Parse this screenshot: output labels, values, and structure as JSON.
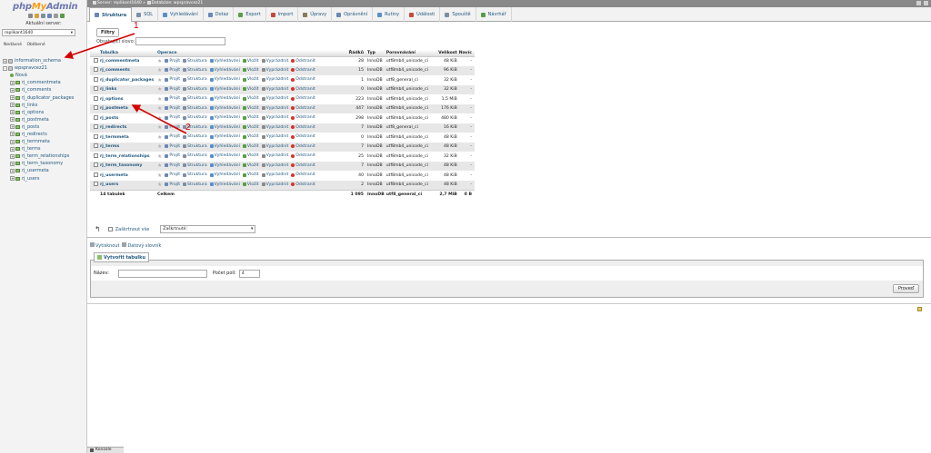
{
  "app": {
    "logo_php": "php",
    "logo_my": "My",
    "logo_admin": "Admin"
  },
  "nav": {
    "server_label": "Aktuální server:",
    "server_value": "replikant1640",
    "recent": "Nedávné",
    "favorites": "Oblíbené",
    "tree": [
      {
        "label": "information_schema",
        "kind": "db",
        "expander": "+"
      },
      {
        "label": "wpspravcez21",
        "kind": "db",
        "expander": "-"
      },
      {
        "label": "Nová",
        "kind": "new"
      },
      {
        "label": "rj_commentmeta",
        "kind": "table"
      },
      {
        "label": "rj_comments",
        "kind": "table"
      },
      {
        "label": "rj_duplicator_packages",
        "kind": "table"
      },
      {
        "label": "rj_links",
        "kind": "table"
      },
      {
        "label": "rj_options",
        "kind": "table"
      },
      {
        "label": "rj_postmeta",
        "kind": "table"
      },
      {
        "label": "rj_posts",
        "kind": "table"
      },
      {
        "label": "rj_redirects",
        "kind": "table"
      },
      {
        "label": "rj_termmeta",
        "kind": "table"
      },
      {
        "label": "rj_terms",
        "kind": "table"
      },
      {
        "label": "rj_term_relationships",
        "kind": "table"
      },
      {
        "label": "rj_term_taxonomy",
        "kind": "table"
      },
      {
        "label": "rj_usermeta",
        "kind": "table"
      },
      {
        "label": "rj_users",
        "kind": "table"
      }
    ]
  },
  "topbar": {
    "server": "Server: replikant1640",
    "sep": "»",
    "database": "Databáze: wpspravcez21"
  },
  "tabs": [
    {
      "label": "Struktura",
      "active": true,
      "color": "#6a87b6"
    },
    {
      "label": "SQL",
      "color": "#7d8fa8"
    },
    {
      "label": "Vyhledávání",
      "color": "#5c8fc7"
    },
    {
      "label": "Dotaz",
      "color": "#6a87b6"
    },
    {
      "label": "Export",
      "color": "#5a9c48"
    },
    {
      "label": "Import",
      "color": "#c44b3d"
    },
    {
      "label": "Úpravy",
      "color": "#8a7a5a"
    },
    {
      "label": "Oprávnění",
      "color": "#6a87b6"
    },
    {
      "label": "Rutiny",
      "color": "#5c8fc7"
    },
    {
      "label": "Události",
      "color": "#c44b3d"
    },
    {
      "label": "Spouště",
      "color": "#7d8fa8"
    },
    {
      "label": "Návrhář",
      "color": "#5a9c48"
    }
  ],
  "filter": {
    "button": "Filtry",
    "label": "Obsahující slovo:",
    "value": ""
  },
  "table": {
    "headers": {
      "table": "Tabulka",
      "ops": "Operace",
      "rows": "Řádků",
      "type": "Typ",
      "collation": "Porovnávání",
      "size": "Velikost",
      "overhead": "Navíc"
    },
    "op_labels": {
      "browse": "Projít",
      "structure": "Struktura",
      "search": "Vyhledávání",
      "insert": "Vložit",
      "empty": "Vyprázdnit",
      "drop": "Odstranit"
    },
    "rows": [
      {
        "name": "rj_commentmeta",
        "rows": "28",
        "type": "InnoDB",
        "collation": "utf8mb4_unicode_ci",
        "size": "48 KiB",
        "overhead": "-"
      },
      {
        "name": "rj_comments",
        "rows": "15",
        "type": "InnoDB",
        "collation": "utf8mb4_unicode_ci",
        "size": "96 KiB",
        "overhead": "-"
      },
      {
        "name": "rj_duplicator_packages",
        "rows": "1",
        "type": "InnoDB",
        "collation": "utf8_general_ci",
        "size": "32 KiB",
        "overhead": "-"
      },
      {
        "name": "rj_links",
        "rows": "0",
        "type": "InnoDB",
        "collation": "utf8mb4_unicode_ci",
        "size": "32 KiB",
        "overhead": "-"
      },
      {
        "name": "rj_options",
        "rows": "223",
        "type": "InnoDB",
        "collation": "utf8mb4_unicode_ci",
        "size": "1,5 MiB",
        "overhead": "-"
      },
      {
        "name": "rj_postmeta",
        "rows": "447",
        "type": "InnoDB",
        "collation": "utf8mb4_unicode_ci",
        "size": "176 KiB",
        "overhead": "-"
      },
      {
        "name": "rj_posts",
        "rows": "298",
        "type": "InnoDB",
        "collation": "utf8mb4_unicode_ci",
        "size": "480 KiB",
        "overhead": "-"
      },
      {
        "name": "rj_redirects",
        "rows": "7",
        "type": "InnoDB",
        "collation": "utf8_general_ci",
        "size": "16 KiB",
        "overhead": "-"
      },
      {
        "name": "rj_termmeta",
        "rows": "0",
        "type": "InnoDB",
        "collation": "utf8mb4_unicode_ci",
        "size": "48 KiB",
        "overhead": "-"
      },
      {
        "name": "rj_terms",
        "rows": "7",
        "type": "InnoDB",
        "collation": "utf8mb4_unicode_ci",
        "size": "48 KiB",
        "overhead": "-"
      },
      {
        "name": "rj_term_relationships",
        "rows": "25",
        "type": "InnoDB",
        "collation": "utf8mb4_unicode_ci",
        "size": "32 KiB",
        "overhead": "-"
      },
      {
        "name": "rj_term_taxonomy",
        "rows": "7",
        "type": "InnoDB",
        "collation": "utf8mb4_unicode_ci",
        "size": "48 KiB",
        "overhead": "-"
      },
      {
        "name": "rj_usermeta",
        "rows": "40",
        "type": "InnoDB",
        "collation": "utf8mb4_unicode_ci",
        "size": "48 KiB",
        "overhead": "-"
      },
      {
        "name": "rj_users",
        "rows": "2",
        "type": "InnoDB",
        "collation": "utf8mb4_unicode_ci",
        "size": "48 KiB",
        "overhead": "-"
      }
    ],
    "summary": {
      "count": "14 tabulek",
      "label": "Celkem",
      "rows": "1 095",
      "type": "InnoDB",
      "collation": "utf8_general_ci",
      "size": "2,7 MiB",
      "overhead": "0 B"
    }
  },
  "bulk": {
    "check_all": "Zaškrtnout vše",
    "with_selected": "Zaškrtnuté:"
  },
  "print": {
    "print": "Vytisknout",
    "dictionary": "Datový slovník"
  },
  "create": {
    "legend": "Vytvořit tabulku",
    "name_label": "Název:",
    "cols_label": "Počet polí:",
    "cols_value": "4",
    "go": "Proveď"
  },
  "console": {
    "label": "Konzole"
  },
  "annotations": {
    "one": "1",
    "two": "2",
    "color": "#d40000"
  }
}
